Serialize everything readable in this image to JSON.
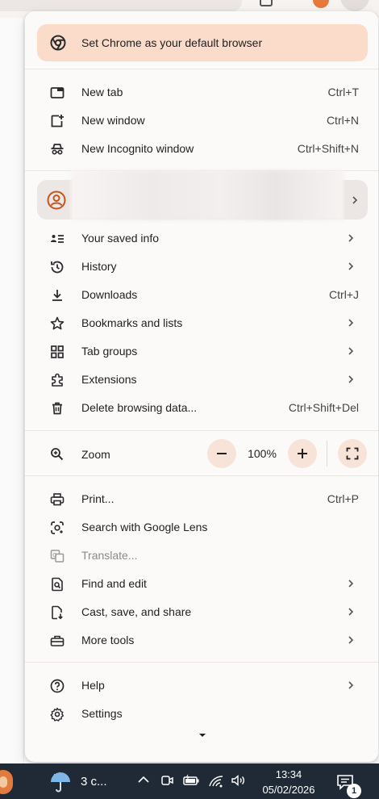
{
  "banner": {
    "label": "Set Chrome as your default browser"
  },
  "sections": {
    "tabs": [
      {
        "label": "New tab",
        "shortcut": "Ctrl+T",
        "icon": "new-tab-icon"
      },
      {
        "label": "New window",
        "shortcut": "Ctrl+N",
        "icon": "new-window-icon"
      },
      {
        "label": "New Incognito window",
        "shortcut": "Ctrl+Shift+N",
        "icon": "incognito-icon"
      }
    ],
    "browse": [
      {
        "label": "Your saved info",
        "icon": "saved-info-icon",
        "submenu": true
      },
      {
        "label": "History",
        "icon": "history-icon",
        "submenu": true
      },
      {
        "label": "Downloads",
        "shortcut": "Ctrl+J",
        "icon": "download-icon"
      },
      {
        "label": "Bookmarks and lists",
        "icon": "star-icon",
        "submenu": true
      },
      {
        "label": "Tab groups",
        "icon": "tab-groups-icon",
        "submenu": true
      },
      {
        "label": "Extensions",
        "icon": "extensions-icon",
        "submenu": true
      },
      {
        "label": "Delete browsing data...",
        "shortcut": "Ctrl+Shift+Del",
        "icon": "trash-icon"
      }
    ],
    "tools": [
      {
        "label": "Print...",
        "shortcut": "Ctrl+P",
        "icon": "print-icon"
      },
      {
        "label": "Search with Google Lens",
        "icon": "lens-icon"
      },
      {
        "label": "Translate...",
        "icon": "translate-icon",
        "disabled": true
      },
      {
        "label": "Find and edit",
        "icon": "find-icon",
        "submenu": true
      },
      {
        "label": "Cast, save, and share",
        "icon": "cast-icon",
        "submenu": true
      },
      {
        "label": "More tools",
        "icon": "toolbox-icon",
        "submenu": true
      }
    ],
    "help": [
      {
        "label": "Help",
        "icon": "help-icon",
        "submenu": true
      },
      {
        "label": "Settings",
        "icon": "gear-icon"
      }
    ]
  },
  "zoom": {
    "label": "Zoom",
    "value": "100%"
  },
  "taskbar": {
    "weather": "3 c...",
    "time": "13:34",
    "date": "05/02/2026",
    "notification_count": "1"
  },
  "colors": {
    "menu_bg": "#fcf9f9",
    "banner_bg": "#fbdccb",
    "accent": "#c5551a",
    "taskbar_bg": "#1f2a36"
  }
}
